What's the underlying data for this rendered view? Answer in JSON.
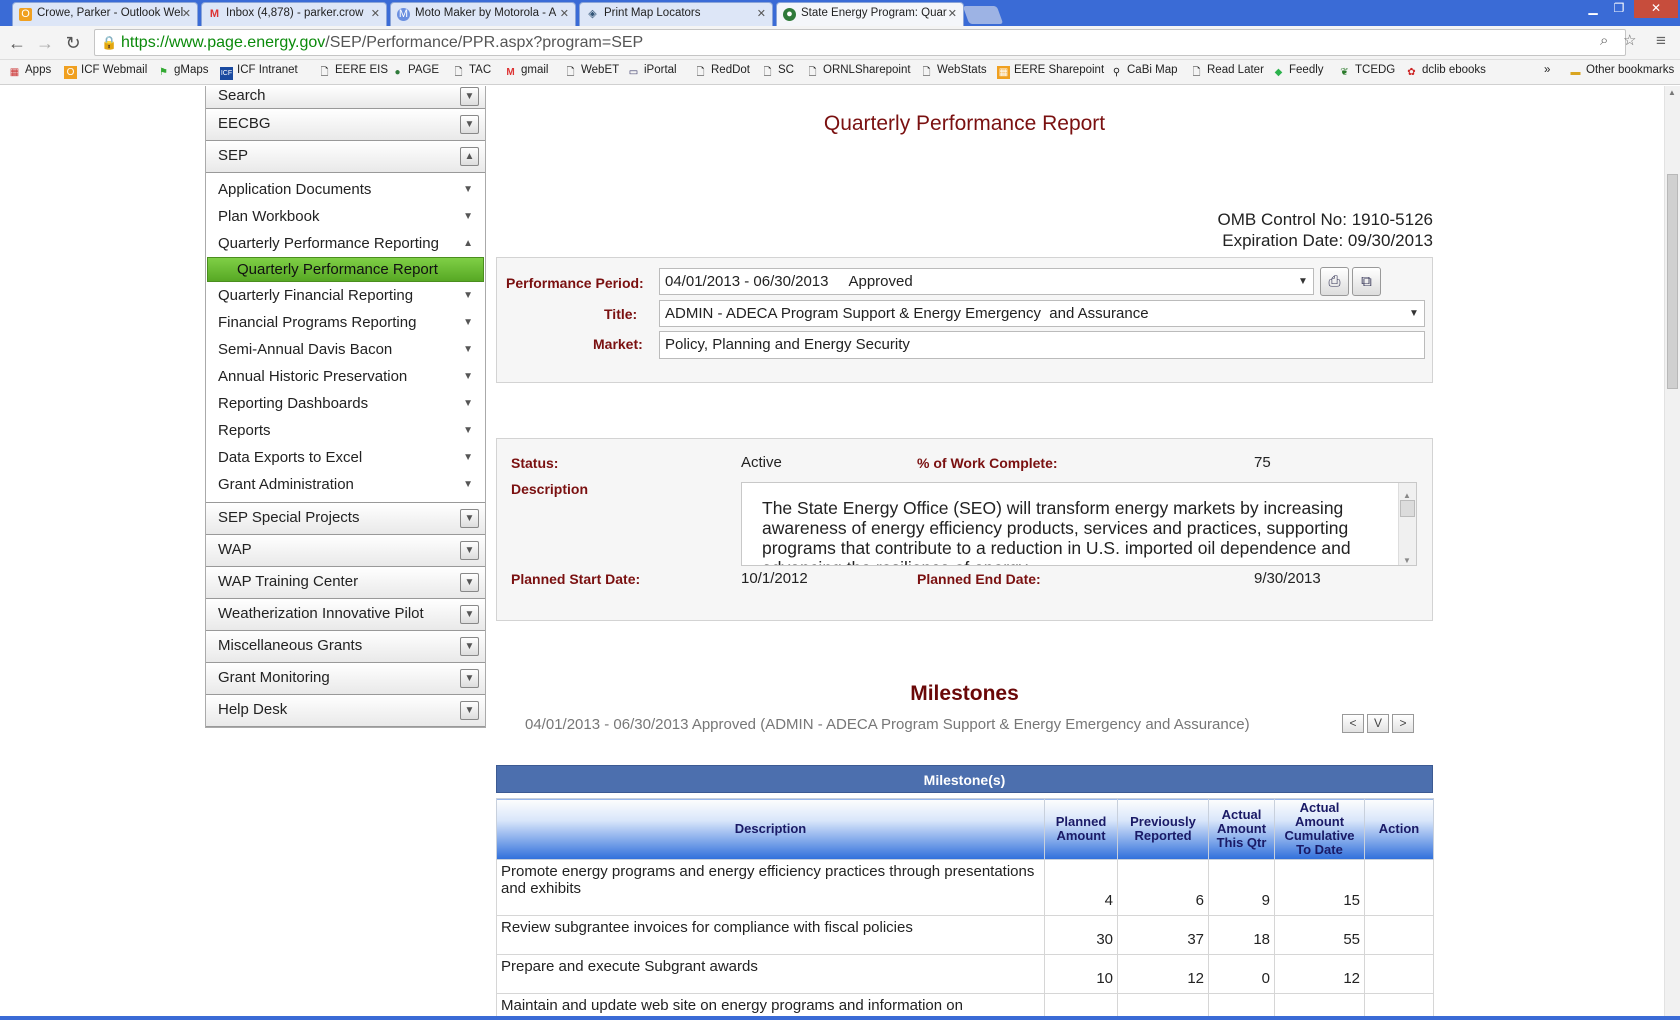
{
  "browser": {
    "tabs": [
      {
        "label": "Crowe, Parker - Outlook Wel",
        "icon": "outlook-icon"
      },
      {
        "label": "Inbox (4,878) - parker.crow",
        "icon": "gmail-icon"
      },
      {
        "label": "Moto Maker by Motorola - A",
        "icon": "motorola-icon"
      },
      {
        "label": "Print Map Locators",
        "icon": "map-icon"
      },
      {
        "label": "State Energy Program: Quar",
        "icon": "energy-icon",
        "active": true
      }
    ],
    "url_scheme": "https://",
    "url_host": "www.page.energy.gov",
    "url_path": "/SEP/Performance/PPR.aspx?program=SEP",
    "bookmarks": [
      "Apps",
      "ICF Webmail",
      "gMaps",
      "ICF Intranet",
      "EERE EIS",
      "PAGE",
      "TAC",
      "gmail",
      "WebET",
      "iPortal",
      "RedDot",
      "SC",
      "ORNLSharepoint",
      "WebStats",
      "EERE Sharepoint",
      "CaBi Map",
      "Read Later",
      "Feedly",
      "TCEDG",
      "dclib ebooks"
    ],
    "bookmarks_overflow": "»",
    "other_bookmarks": "Other bookmarks"
  },
  "sidebar": {
    "sections_top": [
      "Search",
      "EECBG",
      "SEP"
    ],
    "sep_items": [
      "Application Documents",
      "Plan Workbook",
      "Quarterly Performance Reporting",
      "Quarterly Performance Report",
      "Quarterly Financial Reporting",
      "Financial Programs Reporting",
      "Semi-Annual Davis Bacon",
      "Annual Historic Preservation",
      "Reporting Dashboards",
      "Reports",
      "Data Exports to Excel",
      "Grant Administration"
    ],
    "sections_bottom": [
      "SEP Special Projects",
      "WAP",
      "WAP Training Center",
      "Weatherization Innovative Pilot",
      "Miscellaneous Grants",
      "Grant Monitoring",
      "Help Desk"
    ]
  },
  "main": {
    "title": "Quarterly Performance Report",
    "omb_control": "OMB Control No: 1910-5126",
    "expiration": "Expiration Date: 09/30/2013",
    "filters": {
      "period_label": "Performance Period:",
      "period_value": "04/01/2013 - 06/30/2013     Approved",
      "title_label": "Title:",
      "title_value": "ADMIN - ADECA Program Support & Energy Emergency  and Assurance",
      "market_label": "Market:",
      "market_value": "Policy, Planning and Energy Security"
    },
    "details": {
      "status_label": "Status:",
      "status_value": "Active",
      "work_label": "% of Work Complete:",
      "work_value": "75",
      "desc_label": "Description",
      "desc_text": "The State Energy Office (SEO) will transform energy markets by increasing awareness of energy efficiency products, services and practices, supporting programs that contribute to a reduction in U.S. imported oil dependence and advancing the resilience of energy",
      "start_label": "Planned Start Date:",
      "start_value": "10/1/2012",
      "end_label": "Planned End Date:",
      "end_value": "9/30/2013"
    },
    "milestones": {
      "heading": "Milestones",
      "subheading": "04/01/2013 - 06/30/2013 Approved (ADMIN - ADECA Program Support & Energy Emergency and Assurance)",
      "nav": [
        "<",
        "V",
        ">"
      ],
      "table_caption": "Milestone(s)",
      "columns": [
        "Description",
        "Planned Amount",
        "Previously Reported",
        "Actual Amount This Qtr",
        "Actual Amount Cumulative To Date",
        "Action"
      ],
      "rows": [
        {
          "desc": "Promote energy programs and energy efficiency practices through presentations and exhibits",
          "planned": "4",
          "prev": "6",
          "qtr": "9",
          "cum": "15",
          "action": ""
        },
        {
          "desc": "Review subgrantee invoices for compliance with fiscal policies",
          "planned": "30",
          "prev": "37",
          "qtr": "18",
          "cum": "55",
          "action": ""
        },
        {
          "desc": "Prepare and execute Subgrant awards",
          "planned": "10",
          "prev": "12",
          "qtr": "0",
          "cum": "12",
          "action": ""
        },
        {
          "desc": "Maintain and update web site on energy programs and information on",
          "planned": "",
          "prev": "",
          "qtr": "",
          "cum": "",
          "action": ""
        }
      ]
    }
  }
}
